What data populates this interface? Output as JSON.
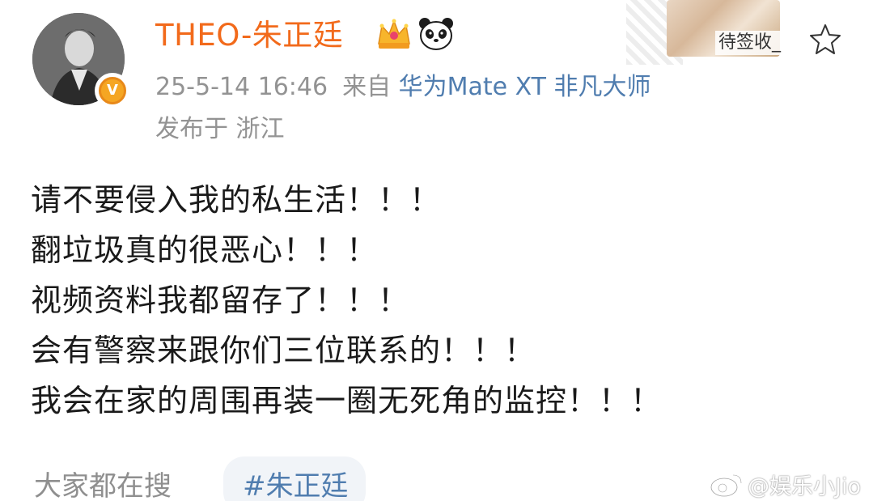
{
  "profile": {
    "username": "THEO-朱正廷",
    "verified": true,
    "badges": [
      "crown-icon",
      "panda-icon"
    ]
  },
  "post_meta": {
    "timestamp": "25-5-14 16:46",
    "source_prefix": "来自",
    "source_device": "华为Mate XT 非凡大师",
    "location": "发布于 浙江"
  },
  "decoration": {
    "text": "待签收_",
    "star_icon": "star-outline-icon"
  },
  "post": {
    "lines": [
      "请不要侵入我的私生活！！！",
      "翻垃圾真的很恶心！！！",
      "视频资料我都留存了！！！",
      "会有警察来跟你们三位联系的！！！",
      "我会在家的周围再装一圈无死角的监控！！！"
    ]
  },
  "bottom": {
    "search_label": "大家都在搜",
    "hashtag": "#朱正廷"
  },
  "watermark": {
    "text": "@娱乐小Jio"
  },
  "colors": {
    "username": "#f26a1b",
    "link": "#507daf",
    "meta": "#939393",
    "body_text": "#1a1a1a",
    "verified_badge": "#f5a623"
  }
}
